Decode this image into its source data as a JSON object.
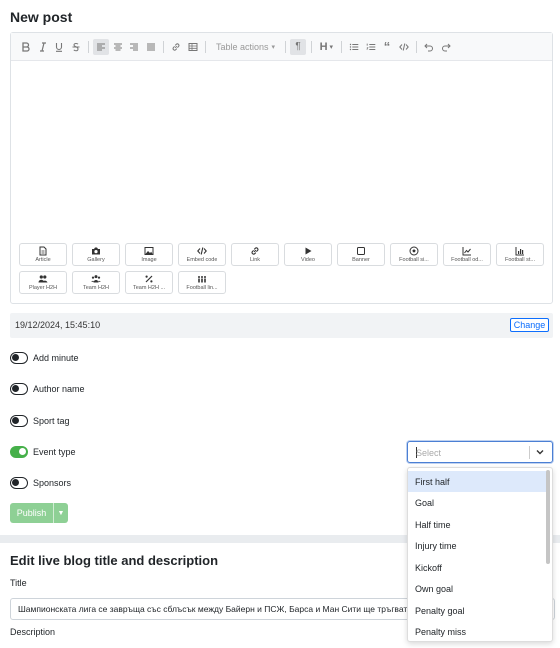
{
  "post": {
    "title": "New post",
    "toolbar": {
      "table_actions": "Table actions"
    },
    "blocks": [
      {
        "label": "Article",
        "icon": "file-icon"
      },
      {
        "label": "Gallery",
        "icon": "camera-icon"
      },
      {
        "label": "Image",
        "icon": "image-icon"
      },
      {
        "label": "Embed code",
        "icon": "code-icon"
      },
      {
        "label": "Link",
        "icon": "link-icon"
      },
      {
        "label": "Video",
        "icon": "play-icon"
      },
      {
        "label": "Banner",
        "icon": "square-icon"
      },
      {
        "label": "Football si...",
        "icon": "football-icon"
      },
      {
        "label": "Football od...",
        "icon": "line-chart-icon"
      },
      {
        "label": "Football st...",
        "icon": "bar-chart-icon"
      },
      {
        "label": "Player H2H",
        "icon": "users-icon"
      },
      {
        "label": "Team H2H",
        "icon": "users-group-icon"
      },
      {
        "label": "Team H2H ...",
        "icon": "percent-icon"
      },
      {
        "label": "Football lin...",
        "icon": "team-icon"
      }
    ],
    "datetime": "19/12/2024, 15:45:10",
    "change_label": "Change",
    "toggles": [
      {
        "label": "Add minute",
        "on": false
      },
      {
        "label": "Author name",
        "on": false
      },
      {
        "label": "Sport tag",
        "on": false
      },
      {
        "label": "Event type",
        "on": true
      },
      {
        "label": "Sponsors",
        "on": false
      }
    ],
    "select": {
      "placeholder": "Select",
      "options": [
        "First half",
        "Goal",
        "Half time",
        "Injury time",
        "Kickoff",
        "Own goal",
        "Penalty goal",
        "Penalty miss"
      ],
      "highlighted": "First half"
    },
    "publish_label": "Publish"
  },
  "live_blog": {
    "title": "Edit live blog title and description",
    "title_label": "Title",
    "title_value": "Шампионската лига се завръща със сблъсък между Байерн и ПСЖ, Барса и Ман Сити ще тръгват",
    "description_label": "Description"
  },
  "colors": {
    "accent": "#0d6efd",
    "toggle_on": "#46b04a",
    "publish": "#8ed095"
  }
}
